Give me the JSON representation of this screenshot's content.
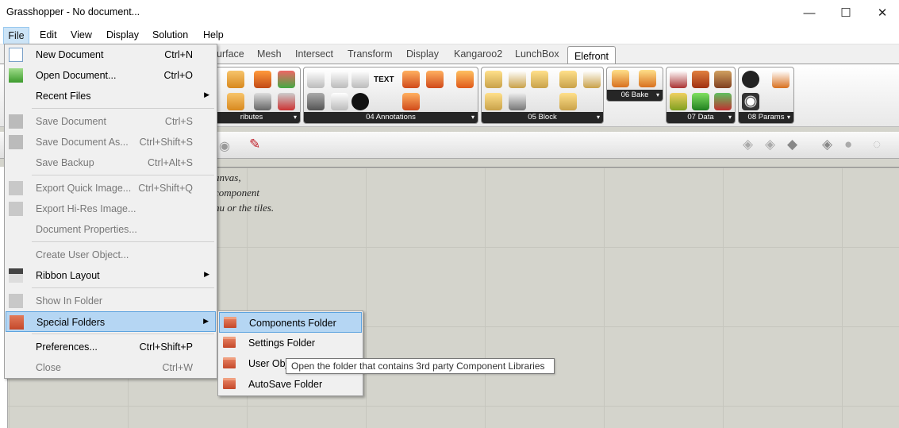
{
  "window": {
    "title": "Grasshopper - No document..."
  },
  "window_controls": {
    "minimize": "—",
    "maximize": "☐",
    "close": "✕"
  },
  "menubar": {
    "file": "File",
    "edit": "Edit",
    "view": "View",
    "display": "Display",
    "solution": "Solution",
    "help": "Help"
  },
  "tabs": {
    "urface": "urface",
    "mesh": "Mesh",
    "intersect": "Intersect",
    "transform": "Transform",
    "display": "Display",
    "kangaroo2": "Kangaroo2",
    "lunchbox": "LunchBox",
    "elefront": "Elefront"
  },
  "ribbon": {
    "attributes": "ributes",
    "annotations": "04 Annotations",
    "block": "05 Block",
    "bake": "06 Bake",
    "data": "07 Data",
    "params": "08 Params",
    "text_icon": "TEXT"
  },
  "canvas_hint": {
    "line1": "anvas,",
    "line2": "component",
    "line3": "nu or the tiles."
  },
  "file_menu": {
    "new_document": {
      "label": "New Document",
      "shortcut": "Ctrl+N"
    },
    "open_document": {
      "label": "Open Document...",
      "shortcut": "Ctrl+O"
    },
    "recent_files": {
      "label": "Recent Files"
    },
    "save_document": {
      "label": "Save Document",
      "shortcut": "Ctrl+S"
    },
    "save_document_as": {
      "label": "Save Document As...",
      "shortcut": "Ctrl+Shift+S"
    },
    "save_backup": {
      "label": "Save Backup",
      "shortcut": "Ctrl+Alt+S"
    },
    "export_quick_image": {
      "label": "Export Quick Image...",
      "shortcut": "Ctrl+Shift+Q"
    },
    "export_hires_image": {
      "label": "Export Hi-Res Image..."
    },
    "document_properties": {
      "label": "Document Properties..."
    },
    "create_user_object": {
      "label": "Create User Object..."
    },
    "ribbon_layout": {
      "label": "Ribbon Layout"
    },
    "show_in_folder": {
      "label": "Show In Folder"
    },
    "special_folders": {
      "label": "Special Folders"
    },
    "preferences": {
      "label": "Preferences...",
      "shortcut": "Ctrl+Shift+P"
    },
    "close": {
      "label": "Close",
      "shortcut": "Ctrl+W"
    }
  },
  "special_folders_menu": {
    "components_folder": "Components Folder",
    "settings_folder": "Settings Folder",
    "user_objects_folder": "User Obj",
    "autosave_folder": "AutoSave Folder"
  },
  "tooltip": {
    "text": "Open the folder that contains 3rd party Component Libraries"
  },
  "colors": {
    "accent_highlight": "#b5d6f3",
    "highlight_border": "#5da3df",
    "canvas": "#d4d4cc",
    "panel_label_bg": "#262626"
  }
}
